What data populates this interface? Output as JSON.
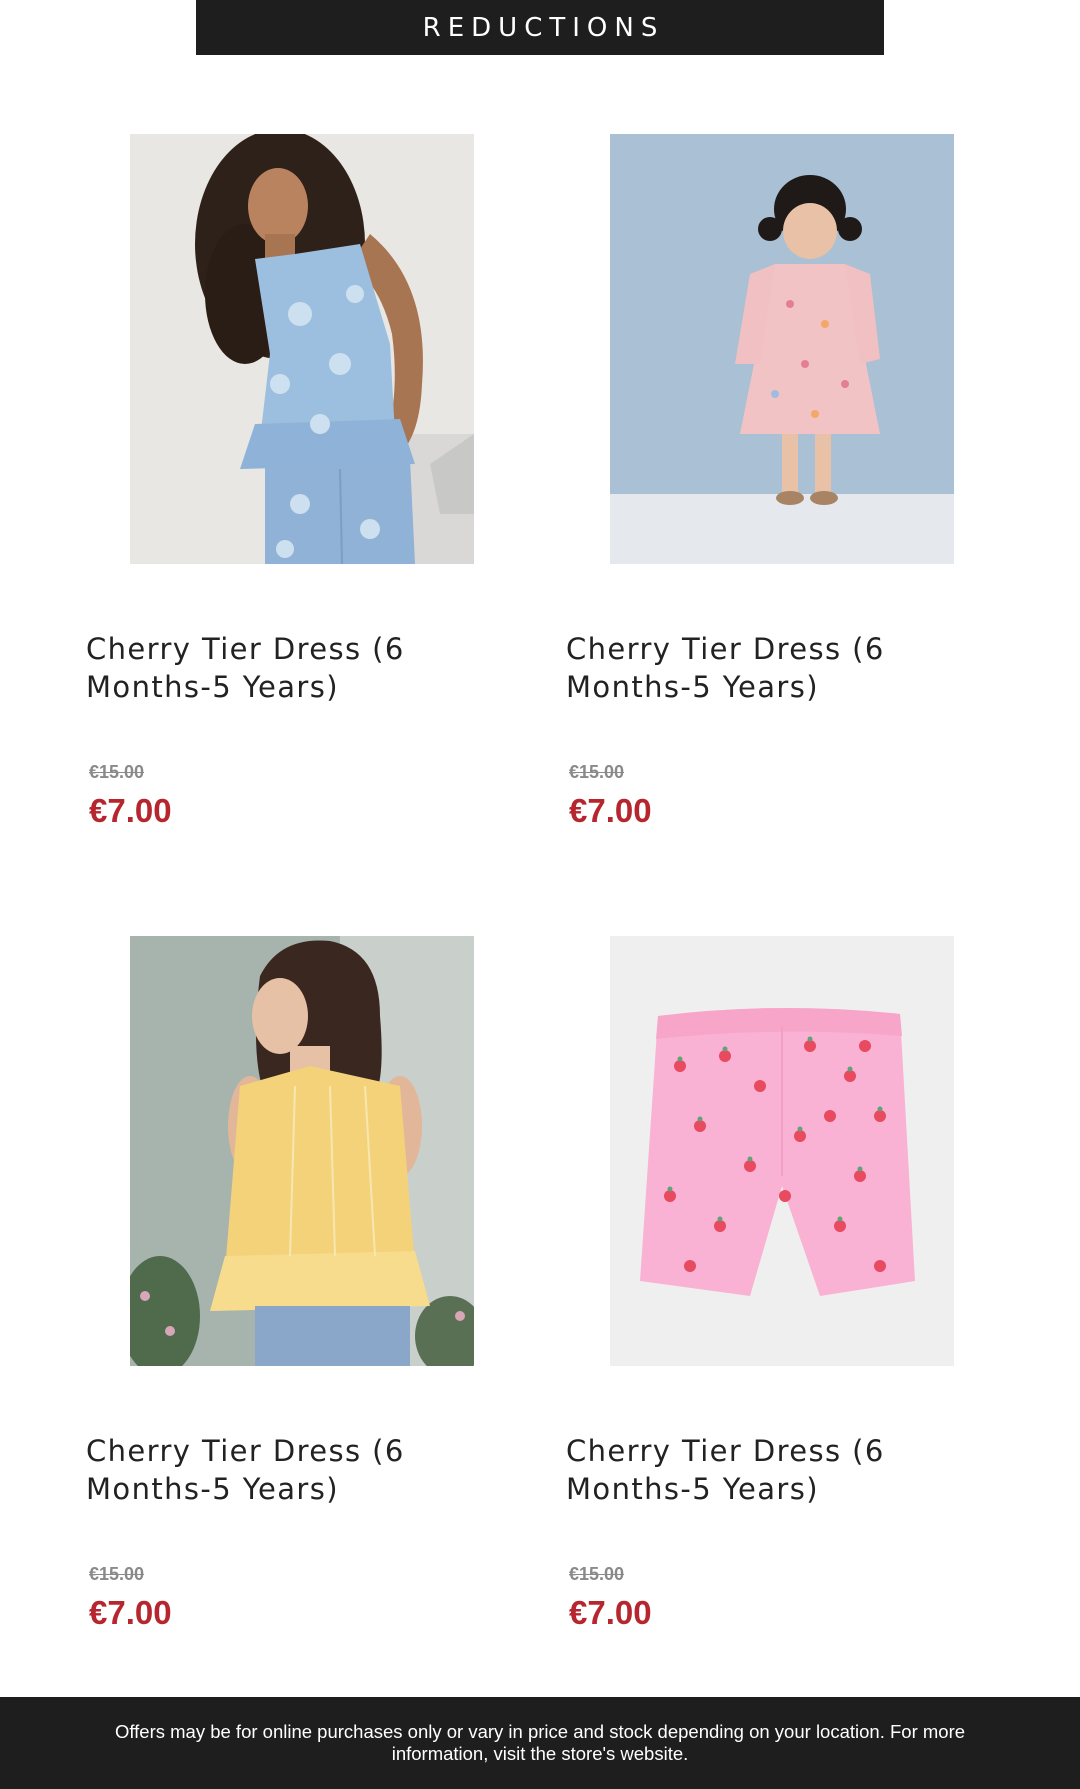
{
  "header": {
    "title": "REDUCTIONS",
    "background": "#1e1e1e"
  },
  "products": [
    {
      "name": "Cherry Tier Dress (6 Months-5 Years)",
      "old_price": "€15.00",
      "price": "€7.00",
      "image": "girl-in-blue-floral-top-photo"
    },
    {
      "name": "Cherry Tier Dress (6 Months-5 Years)",
      "old_price": "€15.00",
      "price": "€7.00",
      "image": "toddler-in-pink-floral-dress-photo"
    },
    {
      "name": "Cherry Tier Dress (6 Months-5 Years)",
      "old_price": "€15.00",
      "price": "€7.00",
      "image": "girl-in-yellow-tulle-top-photo"
    },
    {
      "name": "Cherry Tier Dress (6 Months-5 Years)",
      "old_price": "€15.00",
      "price": "€7.00",
      "image": "pink-strawberry-shorts-photo"
    }
  ],
  "footer": {
    "disclaimer": "Offers may be for online purchases only or vary in price and stock depending on your location. For more information, visit the store's website."
  },
  "colors": {
    "sale_price": "#b5262e",
    "old_price": "#8a8a8a",
    "bars": "#1e1e1e"
  }
}
